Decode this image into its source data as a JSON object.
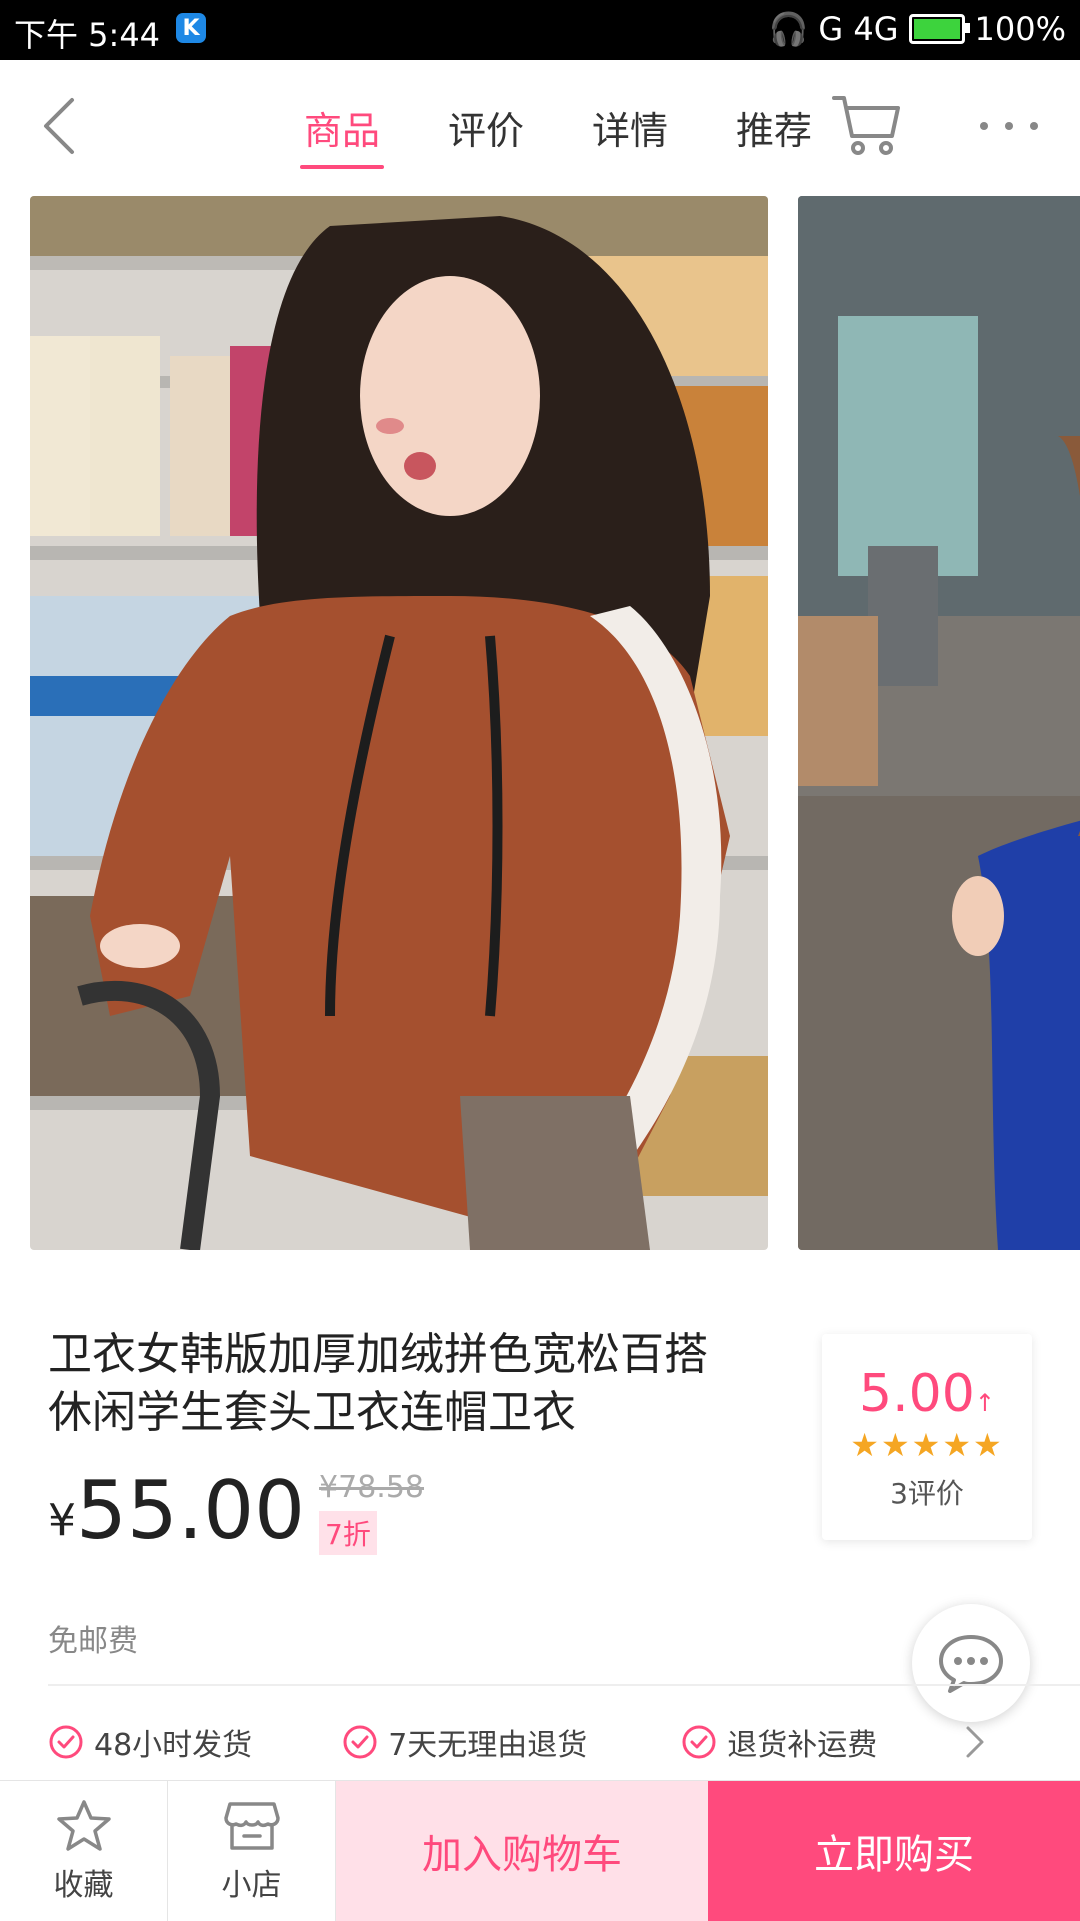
{
  "status_bar": {
    "time": "下午 5:44",
    "network": "G 4G",
    "battery": "100%"
  },
  "nav": {
    "tabs": [
      {
        "label": "商品",
        "active": true
      },
      {
        "label": "评价",
        "active": false
      },
      {
        "label": "详情",
        "active": false
      },
      {
        "label": "推荐",
        "active": false
      }
    ],
    "icons": [
      "back-icon",
      "cart-icon",
      "more-icon"
    ]
  },
  "product": {
    "title": "卫衣女韩版加厚加绒拼色宽松百搭休闲学生套头卫衣连帽卫衣",
    "price_symbol": "¥",
    "price": "55.00",
    "original_price": "¥78.58",
    "discount": "7折",
    "shipping": "免邮费"
  },
  "rating": {
    "score": "5.00",
    "arrow": "↑",
    "stars": "★★★★★",
    "reviews": "3评价"
  },
  "services": [
    {
      "label": "48小时发货"
    },
    {
      "label": "7天无理由退货"
    },
    {
      "label": "退货补运费"
    }
  ],
  "bottom_bar": {
    "favorite": "收藏",
    "shop": "小店",
    "add_to_cart": "加入购物车",
    "buy_now": "立即购买"
  },
  "colors": {
    "accent": "#ff4a7d",
    "accent_light": "#ffe0e8",
    "star": "#f5a623"
  }
}
